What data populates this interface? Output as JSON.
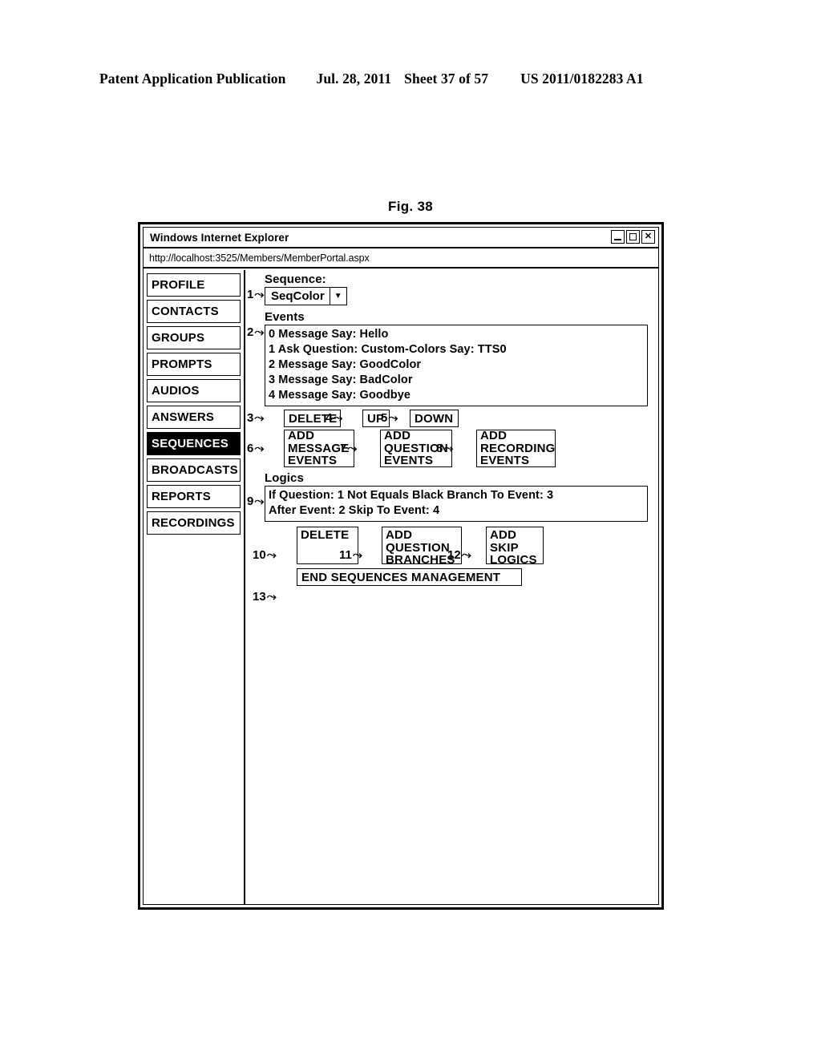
{
  "patent_header": {
    "publication": "Patent Application Publication",
    "date": "Jul. 28, 2011",
    "sheet": "Sheet 37 of 57",
    "number": "US 2011/0182283 A1"
  },
  "figure": {
    "label": "Fig. 38"
  },
  "window": {
    "title": "Windows Internet Explorer",
    "url": "http://localhost:3525/Members/MemberPortal.aspx",
    "controls": {
      "minimize": "_",
      "maximize": "",
      "close": "✕"
    }
  },
  "sidebar": {
    "items": [
      {
        "label": "PROFILE",
        "selected": false
      },
      {
        "label": "CONTACTS",
        "selected": false
      },
      {
        "label": "GROUPS",
        "selected": false
      },
      {
        "label": "PROMPTS",
        "selected": false
      },
      {
        "label": "AUDIOS",
        "selected": false
      },
      {
        "label": "ANSWERS",
        "selected": false
      },
      {
        "label": "SEQUENCES",
        "selected": true
      },
      {
        "label": "BROADCASTS",
        "selected": false
      },
      {
        "label": "REPORTS",
        "selected": false
      },
      {
        "label": "RECORDINGS",
        "selected": false
      }
    ]
  },
  "main": {
    "sequence_label": "Sequence:",
    "sequence_select": {
      "value": "SeqColor",
      "arrow": "▼"
    },
    "events_label": "Events",
    "events": [
      "0 Message Say: Hello",
      "1 Ask Question: Custom-Colors Say: TTS0",
      "2 Message Say: GoodColor",
      "3 Message Say: BadColor",
      "4 Message Say: Goodbye"
    ],
    "event_buttons_row1": [
      {
        "label": "DELETE"
      },
      {
        "label": "UP"
      },
      {
        "label": "DOWN"
      }
    ],
    "event_buttons_row2": [
      {
        "line1": "ADD",
        "line2": "MESSAGE",
        "line3": "EVENTS"
      },
      {
        "line1": "ADD",
        "line2": "QUESTION",
        "line3": "EVENTS"
      },
      {
        "line1": "ADD",
        "line2": "RECORDING",
        "line3": "EVENTS"
      }
    ],
    "logics_label": "Logics",
    "logics": [
      "If Question: 1 Not Equals Black Branch To Event: 3",
      "After Event: 2 Skip To Event: 4"
    ],
    "logic_buttons": [
      {
        "line1": "DELETE",
        "line2": "",
        "line3": ""
      },
      {
        "line1": "ADD",
        "line2": "QUESTION",
        "line3": "BRANCHES"
      },
      {
        "line1": "ADD",
        "line2": "SKIP",
        "line3": "LOGICS"
      }
    ],
    "end_button": "END SEQUENCES MANAGEMENT"
  },
  "callouts": {
    "c1": "1",
    "c2": "2",
    "c3": "3",
    "c4": "4",
    "c5": "5",
    "c6": "6",
    "c7": "7",
    "c8": "8",
    "c9": "9",
    "c10": "10",
    "c11": "11",
    "c12": "12",
    "c13": "13",
    "leader": "⤳"
  }
}
